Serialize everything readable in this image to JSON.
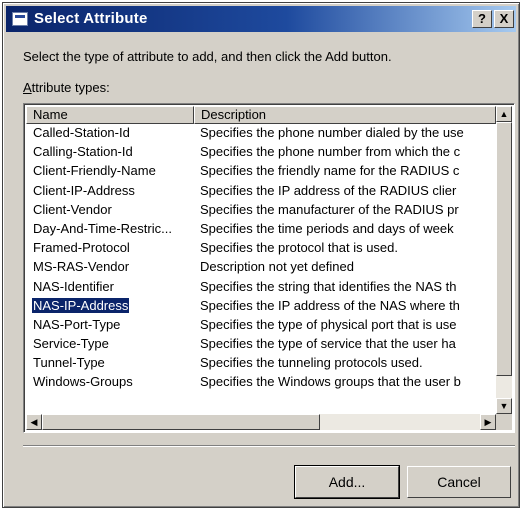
{
  "dialog": {
    "title": "Select Attribute",
    "help_label": "?",
    "close_label": "X"
  },
  "instruction": "Select the type of attribute to add, and then click the Add button.",
  "attribute_types_label": {
    "underlined": "A",
    "rest": "ttribute types:"
  },
  "columns": {
    "name": "Name",
    "description": "Description"
  },
  "rows": [
    {
      "name": "Called-Station-Id",
      "description": "Specifies the phone number dialed by the use",
      "selected": false
    },
    {
      "name": "Calling-Station-Id",
      "description": "Specifies the phone number from which the c",
      "selected": false
    },
    {
      "name": "Client-Friendly-Name",
      "description": "Specifies the friendly name for the RADIUS c",
      "selected": false
    },
    {
      "name": "Client-IP-Address",
      "description": "Specifies the IP address of the RADIUS clier",
      "selected": false
    },
    {
      "name": "Client-Vendor",
      "description": "Specifies the manufacturer of the RADIUS pr",
      "selected": false
    },
    {
      "name": "Day-And-Time-Restric...",
      "description": "Specifies the time periods and days of week",
      "selected": false
    },
    {
      "name": "Framed-Protocol",
      "description": "Specifies the protocol that is used.",
      "selected": false
    },
    {
      "name": "MS-RAS-Vendor",
      "description": "Description not yet defined",
      "selected": false
    },
    {
      "name": "NAS-Identifier",
      "description": "Specifies the string that identifies the NAS th",
      "selected": false
    },
    {
      "name": "NAS-IP-Address",
      "description": "Specifies the IP address of the NAS where th",
      "selected": true
    },
    {
      "name": "NAS-Port-Type",
      "description": "Specifies the type of physical port that is use",
      "selected": false
    },
    {
      "name": "Service-Type",
      "description": "Specifies the type of service that the user ha",
      "selected": false
    },
    {
      "name": "Tunnel-Type",
      "description": "Specifies the tunneling protocols used.",
      "selected": false
    },
    {
      "name": "Windows-Groups",
      "description": "Specifies the Windows groups that the user b",
      "selected": false
    }
  ],
  "buttons": {
    "add": "Add...",
    "cancel": "Cancel"
  },
  "scroll": {
    "up": "▲",
    "down": "▼",
    "left": "◀",
    "right": "▶"
  }
}
